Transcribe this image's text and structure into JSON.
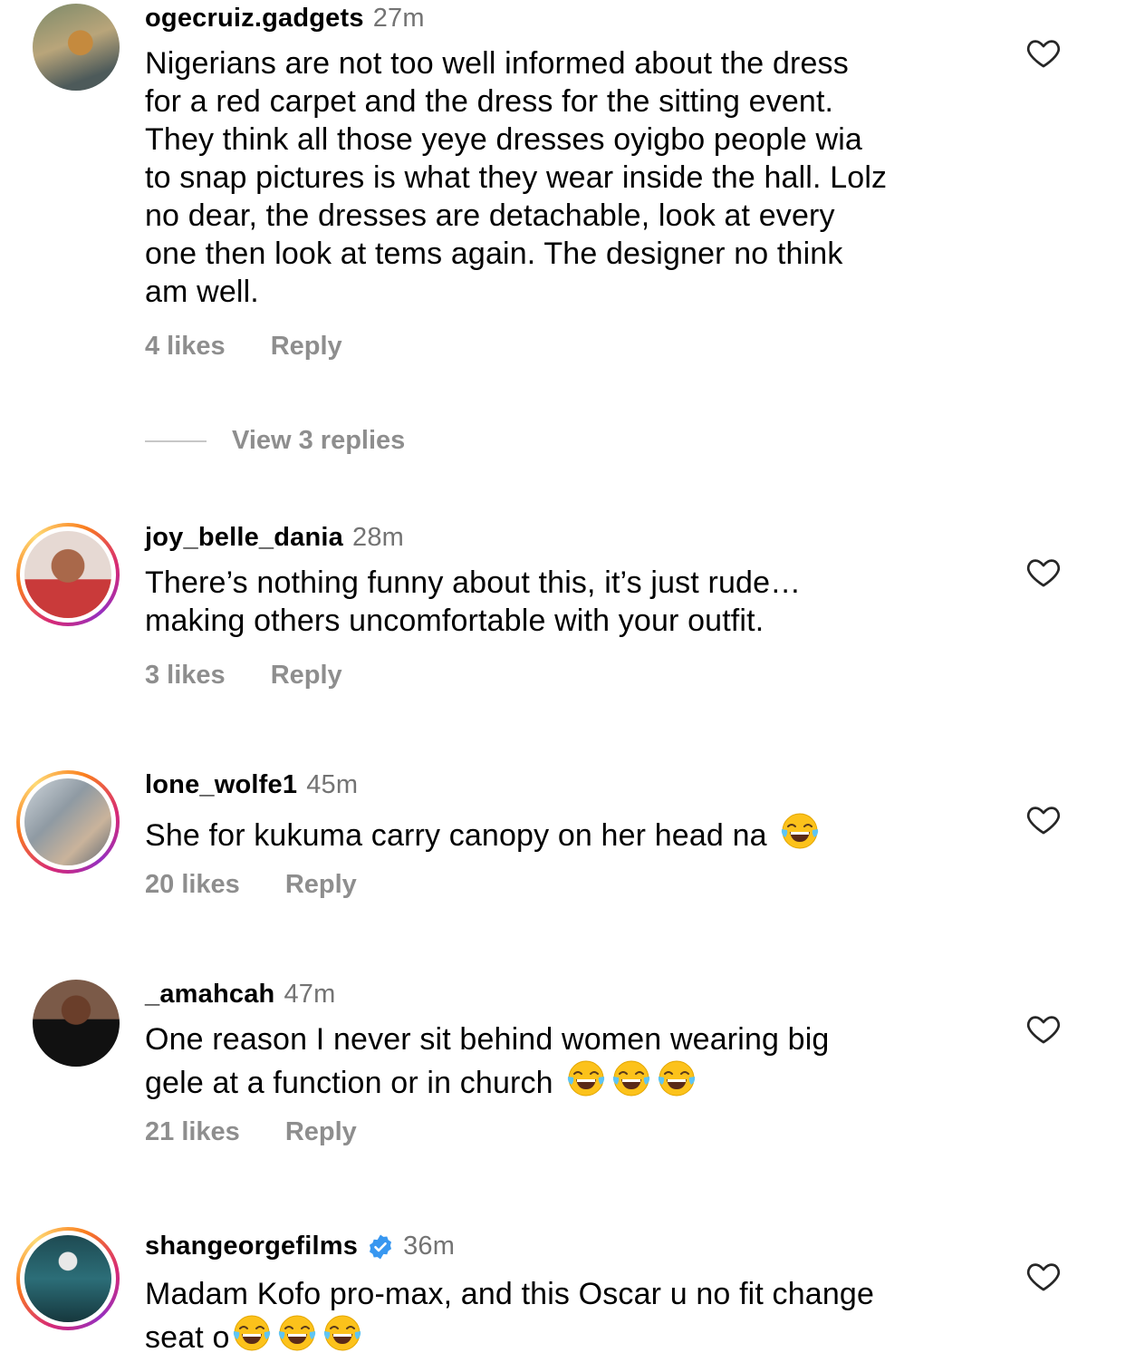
{
  "comments": [
    {
      "username": "ogecruiz.gadgets",
      "time": "27m",
      "lines": [
        "Nigerians are not too well informed about the dress",
        "for a red carpet and the dress for the sitting event.",
        "They think all those yeye dresses oyigbo people wia",
        "to snap pictures is what they wear inside the hall. Lolz",
        "no dear, the dresses are detachable, look at every",
        "one then look at tems again.  The designer no think",
        "am well."
      ],
      "likes": "4 likes",
      "reply": "Reply",
      "view_replies": "View 3 replies"
    },
    {
      "username": "joy_belle_dania",
      "time": "28m",
      "lines": [
        "There’s nothing funny about this, it’s just rude…",
        "making others uncomfortable with your outfit."
      ],
      "likes": "3 likes",
      "reply": "Reply"
    },
    {
      "username": "lone_wolfe1",
      "time": "45m",
      "lines": [
        "She for kukuma carry canopy on her head na"
      ],
      "emoji_count": 1,
      "likes": "20 likes",
      "reply": "Reply"
    },
    {
      "username": "_amahcah",
      "time": "47m",
      "lines": [
        "One reason I never sit behind women wearing big",
        "gele at a function or in church"
      ],
      "emoji_count": 3,
      "likes": "21 likes",
      "reply": "Reply"
    },
    {
      "username": "shangeorgefilms",
      "time": "36m",
      "verified": true,
      "lines": [
        "Madam Kofo pro-max, and this Oscar u no fit change",
        "seat o"
      ],
      "emoji_count": 3
    }
  ],
  "icons": {
    "heart": "heart-outline-icon",
    "verified": "verified-badge-icon",
    "emoji": "face-with-tears-of-joy-emoji"
  },
  "colors": {
    "text": "#000000",
    "secondary": "#737373",
    "meta": "#8e8e8e",
    "verified": "#3897f0"
  }
}
